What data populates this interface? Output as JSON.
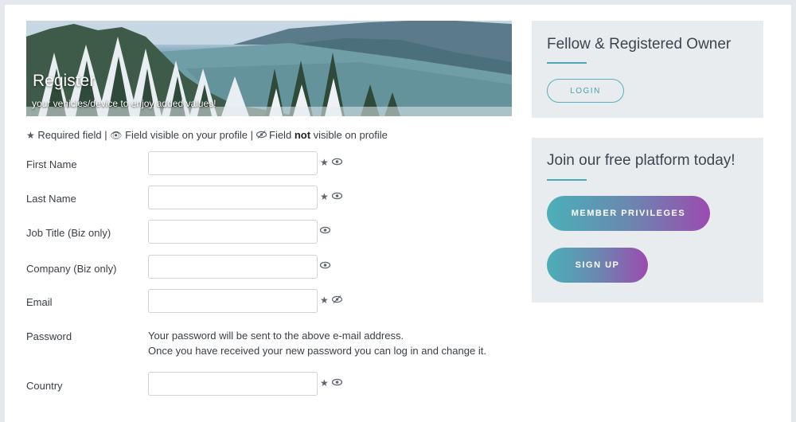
{
  "banner": {
    "title": "Register",
    "subtitle": "your vehicles/device to enjoy added values!"
  },
  "legend": {
    "required_text": "Required field",
    "sep1": "|",
    "visible_text": "Field visible on your profile",
    "sep2": "|",
    "field_text": "Field",
    "not_text": "not",
    "not_visible_text": "visible on profile",
    "icons": [
      "star-icon",
      "eye-icon",
      "eye-slash-icon"
    ]
  },
  "form": {
    "first_name": {
      "label": "First Name",
      "value": "",
      "required": true,
      "visibility": "visible"
    },
    "last_name": {
      "label": "Last Name",
      "value": "",
      "required": true,
      "visibility": "visible"
    },
    "job_title": {
      "label": "Job Title (Biz only)",
      "value": "",
      "required": false,
      "visibility": "visible"
    },
    "company": {
      "label": "Company (Biz only)",
      "value": "",
      "required": false,
      "visibility": "visible"
    },
    "email": {
      "label": "Email",
      "value": "",
      "required": true,
      "visibility": "hidden"
    },
    "password": {
      "label": "Password",
      "note_line1": "Your password will be sent to the above e-mail address.",
      "note_line2": "Once you have received your new password you can log in and change it."
    },
    "country": {
      "label": "Country",
      "value": "",
      "required": true,
      "visibility": "visible"
    }
  },
  "panel_owner": {
    "title": "Fellow & Registered Owner",
    "login_label": "LOGIN"
  },
  "panel_join": {
    "title": "Join our free platform today!",
    "privileges_label": "MEMBER  PRIVILEGES",
    "signup_label": "SIGN UP"
  },
  "colors": {
    "accent": "#4aa8b8",
    "gradient_start": "#4ab0b8",
    "gradient_end": "#9b4bb0",
    "panel_bg": "#e8ecef"
  }
}
